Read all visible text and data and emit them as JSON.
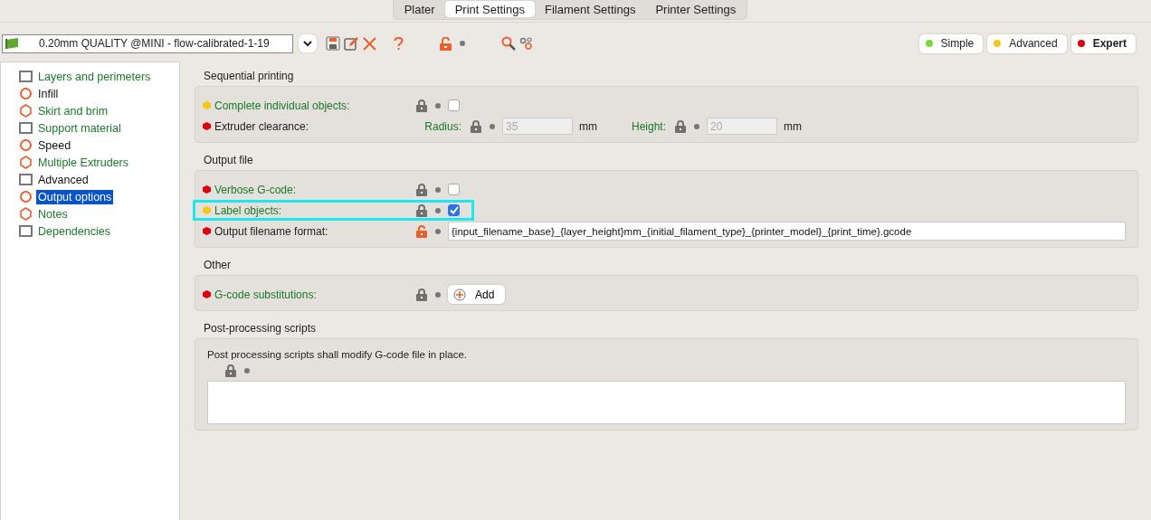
{
  "tabs": [
    {
      "label": "Plater",
      "selected": false
    },
    {
      "label": "Print Settings",
      "selected": true
    },
    {
      "label": "Filament Settings",
      "selected": false
    },
    {
      "label": "Printer Settings",
      "selected": false
    }
  ],
  "preset": {
    "value": "0.20mm QUALITY @MINI - flow-calibrated-1-19"
  },
  "modes": [
    {
      "label": "Simple",
      "color": "#7ed63a",
      "selected": false
    },
    {
      "label": "Advanced",
      "color": "#f5c518",
      "selected": false
    },
    {
      "label": "Expert",
      "color": "#e0000f",
      "selected": true
    }
  ],
  "sidebar": {
    "items": [
      {
        "label": "Layers and perimeters",
        "system": true,
        "selected": false
      },
      {
        "label": "Infill",
        "system": false,
        "selected": false
      },
      {
        "label": "Skirt and brim",
        "system": true,
        "selected": false
      },
      {
        "label": "Support material",
        "system": true,
        "selected": false
      },
      {
        "label": "Speed",
        "system": false,
        "selected": false
      },
      {
        "label": "Multiple Extruders",
        "system": true,
        "selected": false
      },
      {
        "label": "Advanced",
        "system": false,
        "selected": false
      },
      {
        "label": "Output options",
        "system": false,
        "selected": true
      },
      {
        "label": "Notes",
        "system": true,
        "selected": false
      },
      {
        "label": "Dependencies",
        "system": true,
        "selected": false
      }
    ]
  },
  "sections": [
    {
      "title": "Sequential printing",
      "rows": [
        {
          "kind": "checkbox",
          "label": "Complete individual objects:",
          "color": "#f5c518",
          "system": true,
          "locked": true,
          "checked": false,
          "highlighted": false
        },
        {
          "kind": "pair",
          "label": "Extruder clearance:",
          "color": "#e0000f",
          "system": false,
          "highlighted": false,
          "fields": [
            {
              "label": "Radius:",
              "system": true,
              "locked": true,
              "value": "35",
              "unit": "mm",
              "disabled": true
            },
            {
              "label": "Height:",
              "system": true,
              "locked": true,
              "value": "20",
              "unit": "mm",
              "disabled": true
            }
          ]
        }
      ]
    },
    {
      "title": "Output file",
      "rows": [
        {
          "kind": "checkbox",
          "label": "Verbose G-code:",
          "color": "#e0000f",
          "system": true,
          "locked": true,
          "checked": false,
          "highlighted": false
        },
        {
          "kind": "checkbox",
          "label": "Label objects:",
          "color": "#f5c518",
          "system": true,
          "locked": true,
          "checked": true,
          "highlighted": true
        },
        {
          "kind": "text",
          "label": "Output filename format:",
          "color": "#e0000f",
          "system": false,
          "locked": false,
          "value": "{input_filename_base}_{layer_height}mm_{initial_filament_type}_{printer_model}_{print_time}.gcode",
          "highlighted": false
        }
      ]
    },
    {
      "title": "Other",
      "rows": [
        {
          "kind": "button",
          "label": "G-code substitutions:",
          "color": "#e0000f",
          "system": true,
          "locked": true,
          "button": "Add",
          "highlighted": false
        }
      ]
    },
    {
      "title": "Post-processing scripts",
      "rows": [
        {
          "kind": "textarea",
          "note": "Post processing scripts shall modify G-code file in place.",
          "locked": true,
          "highlighted": false
        }
      ]
    }
  ]
}
